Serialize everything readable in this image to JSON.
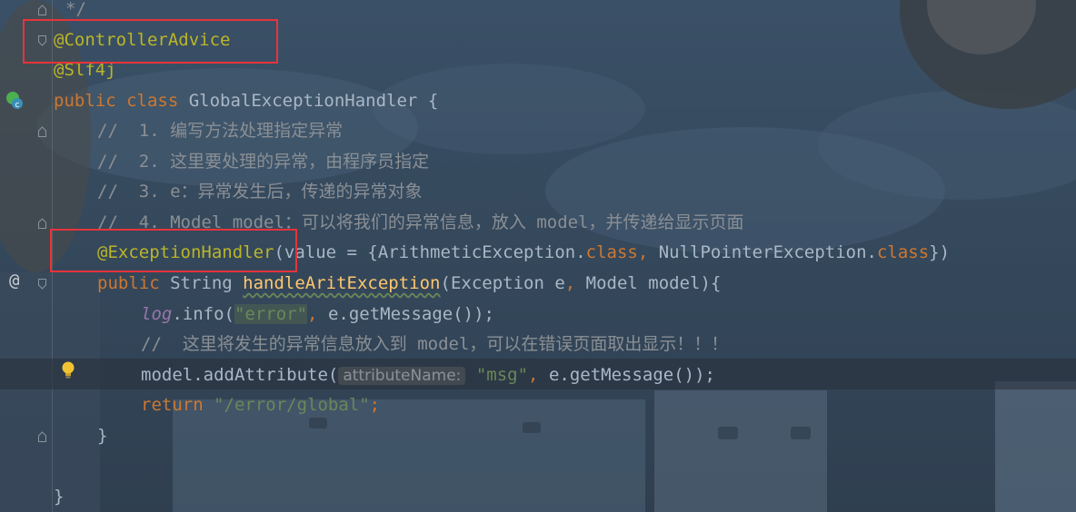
{
  "colors": {
    "comment": "#8a8f95",
    "annotation": "#bbb529",
    "keyword": "#cc7832",
    "plain": "#a9b7c6",
    "method": "#ffc66d",
    "string": "#6a8759",
    "static_field": "#9876aa",
    "highlight_box": "#e8333a"
  },
  "gutter": {
    "at_marker": "@",
    "class_badge": "c",
    "bulb_icon": "lightbulb-icon",
    "implement_icon": "override-marker-icon"
  },
  "code_lines": [
    {
      "tokens": [
        {
          "text": "*/",
          "kind": "comment"
        }
      ]
    },
    {
      "tokens": [
        {
          "text": "@ControllerAdvice",
          "kind": "anno"
        }
      ]
    },
    {
      "tokens": [
        {
          "text": "@Slf4j",
          "kind": "anno"
        }
      ]
    },
    {
      "tokens": [
        {
          "text": "public ",
          "kind": "keyword"
        },
        {
          "text": "class ",
          "kind": "keyword"
        },
        {
          "text": "GlobalExceptionHandler {",
          "kind": "plain"
        }
      ]
    },
    {
      "tokens": [
        {
          "text": "//  1. 编写方法处理指定异常",
          "kind": "comment"
        }
      ]
    },
    {
      "tokens": [
        {
          "text": "//  2. 这里要处理的异常，由程序员指定",
          "kind": "comment"
        }
      ]
    },
    {
      "tokens": [
        {
          "text": "//  3. e：异常发生后，传递的异常对象",
          "kind": "comment"
        }
      ]
    },
    {
      "tokens": [
        {
          "text": "//  4. Model model：可以将我们的异常信息，放入 model，并传递给显示页面",
          "kind": "comment"
        }
      ]
    },
    {
      "tokens": [
        {
          "text": "@ExceptionHandler",
          "kind": "anno"
        },
        {
          "text": "(value = {ArithmeticException.",
          "kind": "plain"
        },
        {
          "text": "class",
          "kind": "keyword"
        },
        {
          "text": ", ",
          "kind": "keyword"
        },
        {
          "text": "NullPointerException.",
          "kind": "plain"
        },
        {
          "text": "class",
          "kind": "keyword"
        },
        {
          "text": "})",
          "kind": "plain"
        }
      ]
    },
    {
      "tokens": [
        {
          "text": "public ",
          "kind": "keyword"
        },
        {
          "text": "String ",
          "kind": "plain"
        },
        {
          "text": "handleAritException",
          "kind": "method-sq"
        },
        {
          "text": "(Exception e",
          "kind": "plain"
        },
        {
          "text": ", ",
          "kind": "keyword"
        },
        {
          "text": "Model model){",
          "kind": "plain"
        }
      ]
    },
    {
      "tokens": [
        {
          "text": "log",
          "kind": "static"
        },
        {
          "text": ".info(",
          "kind": "plain"
        },
        {
          "text": "\"error\"",
          "kind": "string-hl"
        },
        {
          "text": ", ",
          "kind": "keyword"
        },
        {
          "text": "e.getMessage());",
          "kind": "plain"
        }
      ]
    },
    {
      "tokens": [
        {
          "text": "//  这里将发生的异常信息放入到 model，可以在错误页面取出显示！！！",
          "kind": "comment"
        }
      ]
    },
    {
      "tokens": [
        {
          "text": "model.addAttribute(",
          "kind": "plain"
        },
        {
          "text": "attributeName:",
          "kind": "hint"
        },
        {
          "text": " ",
          "kind": "plain"
        },
        {
          "text": "\"msg\"",
          "kind": "string"
        },
        {
          "text": ", ",
          "kind": "keyword"
        },
        {
          "text": "e.getMessage());",
          "kind": "plain"
        }
      ]
    },
    {
      "tokens": [
        {
          "text": "return ",
          "kind": "keyword"
        },
        {
          "text": "\"/error/global\"",
          "kind": "string"
        },
        {
          "text": ";",
          "kind": "keyword"
        }
      ]
    },
    {
      "tokens": [
        {
          "text": "}",
          "kind": "plain"
        }
      ]
    },
    {
      "tokens": [
        {
          "text": "",
          "kind": "plain"
        }
      ]
    },
    {
      "tokens": [
        {
          "text": "}",
          "kind": "plain"
        }
      ]
    }
  ]
}
